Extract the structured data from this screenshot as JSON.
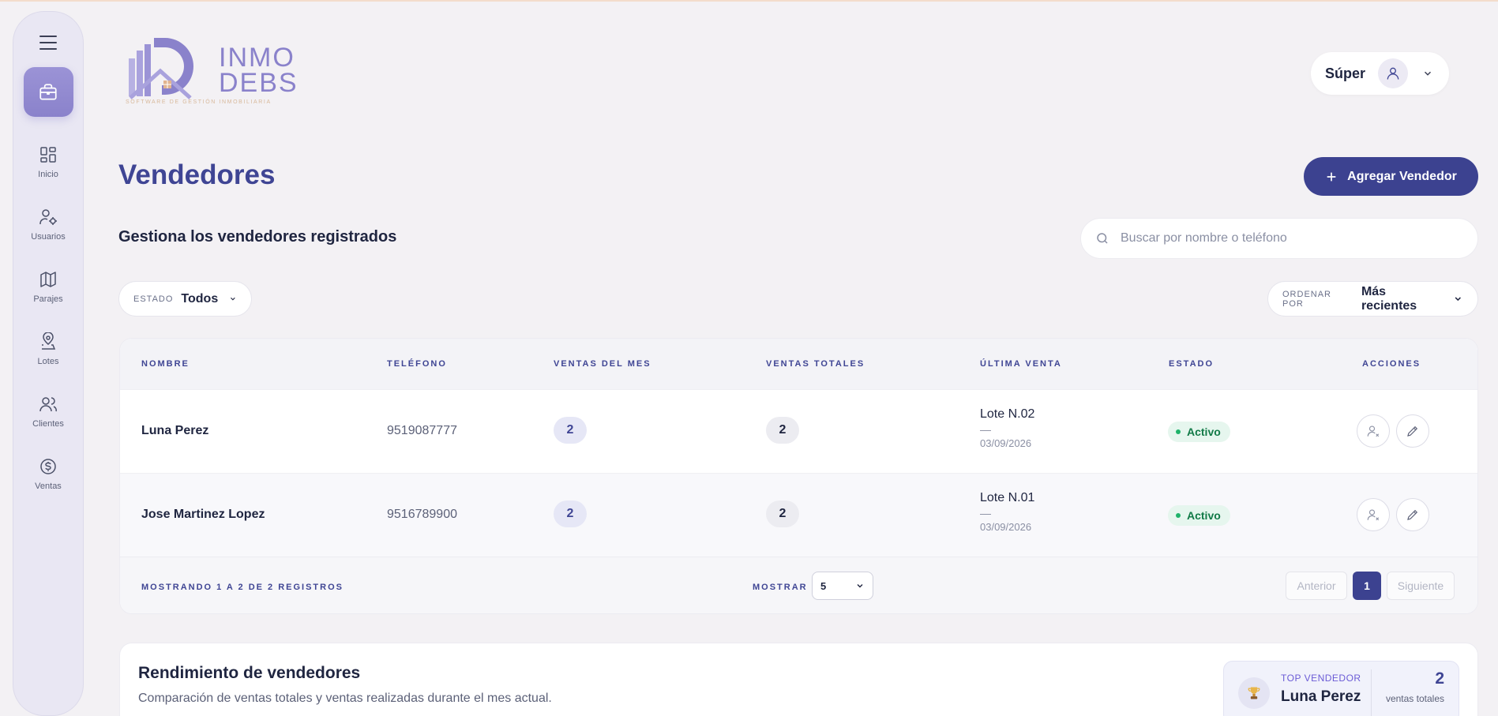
{
  "sidebar": {
    "items": [
      {
        "label": "Inicio",
        "icon": "grid-icon"
      },
      {
        "label": "Usuarios",
        "icon": "user-gear-icon"
      },
      {
        "label": "Parajes",
        "icon": "map-icon"
      },
      {
        "label": "Lotes",
        "icon": "map-pin-icon"
      },
      {
        "label": "Clientes",
        "icon": "users-icon"
      },
      {
        "label": "Ventas",
        "icon": "dollar-icon"
      }
    ],
    "active_icon": "briefcase-icon"
  },
  "logo": {
    "line1": "INMO",
    "line2": "DEBS",
    "tagline": "SOFTWARE DE GESTIÓN INMOBILIARIA"
  },
  "user": {
    "name": "Súper"
  },
  "page": {
    "title": "Vendedores",
    "subtitle": "Gestiona los vendedores registrados",
    "add_button": "Agregar Vendedor"
  },
  "search": {
    "placeholder": "Buscar por nombre o teléfono"
  },
  "filters": {
    "estado_label": "ESTADO",
    "estado_value": "Todos",
    "orden_label": "ORDENAR POR",
    "orden_value": "Más recientes"
  },
  "table": {
    "headers": [
      "NOMBRE",
      "TELÉFONO",
      "VENTAS DEL MES",
      "VENTAS TOTALES",
      "ÚLTIMA VENTA",
      "ESTADO",
      "ACCIONES"
    ],
    "rows": [
      {
        "nombre": "Luna Perez",
        "telefono": "9519087777",
        "ventas_mes": "2",
        "ventas_totales": "2",
        "ultima_lote": "Lote N.02",
        "ultima_dash": "—",
        "ultima_fecha": "03/09/2026",
        "estado": "Activo"
      },
      {
        "nombre": "Jose Martinez Lopez",
        "telefono": "9516789900",
        "ventas_mes": "2",
        "ventas_totales": "2",
        "ultima_lote": "Lote N.01",
        "ultima_dash": "—",
        "ultima_fecha": "03/09/2026",
        "estado": "Activo"
      }
    ],
    "footer": {
      "info": "MOSTRANDO 1 A 2 DE 2 REGISTROS",
      "show_label": "MOSTRAR",
      "page_size": "5",
      "prev": "Anterior",
      "current_page": "1",
      "next": "Siguiente"
    }
  },
  "performance": {
    "title": "Rendimiento de vendedores",
    "subtitle": "Comparación de ventas totales y ventas realizadas durante el mes actual.",
    "top_label": "TOP VENDEDOR",
    "top_name": "Luna Perez",
    "top_value": "2",
    "top_unit": "ventas totales"
  },
  "colors": {
    "accent": "#3c4290",
    "sidebar_active": "#9b93d6",
    "status_active": "#127a47"
  }
}
